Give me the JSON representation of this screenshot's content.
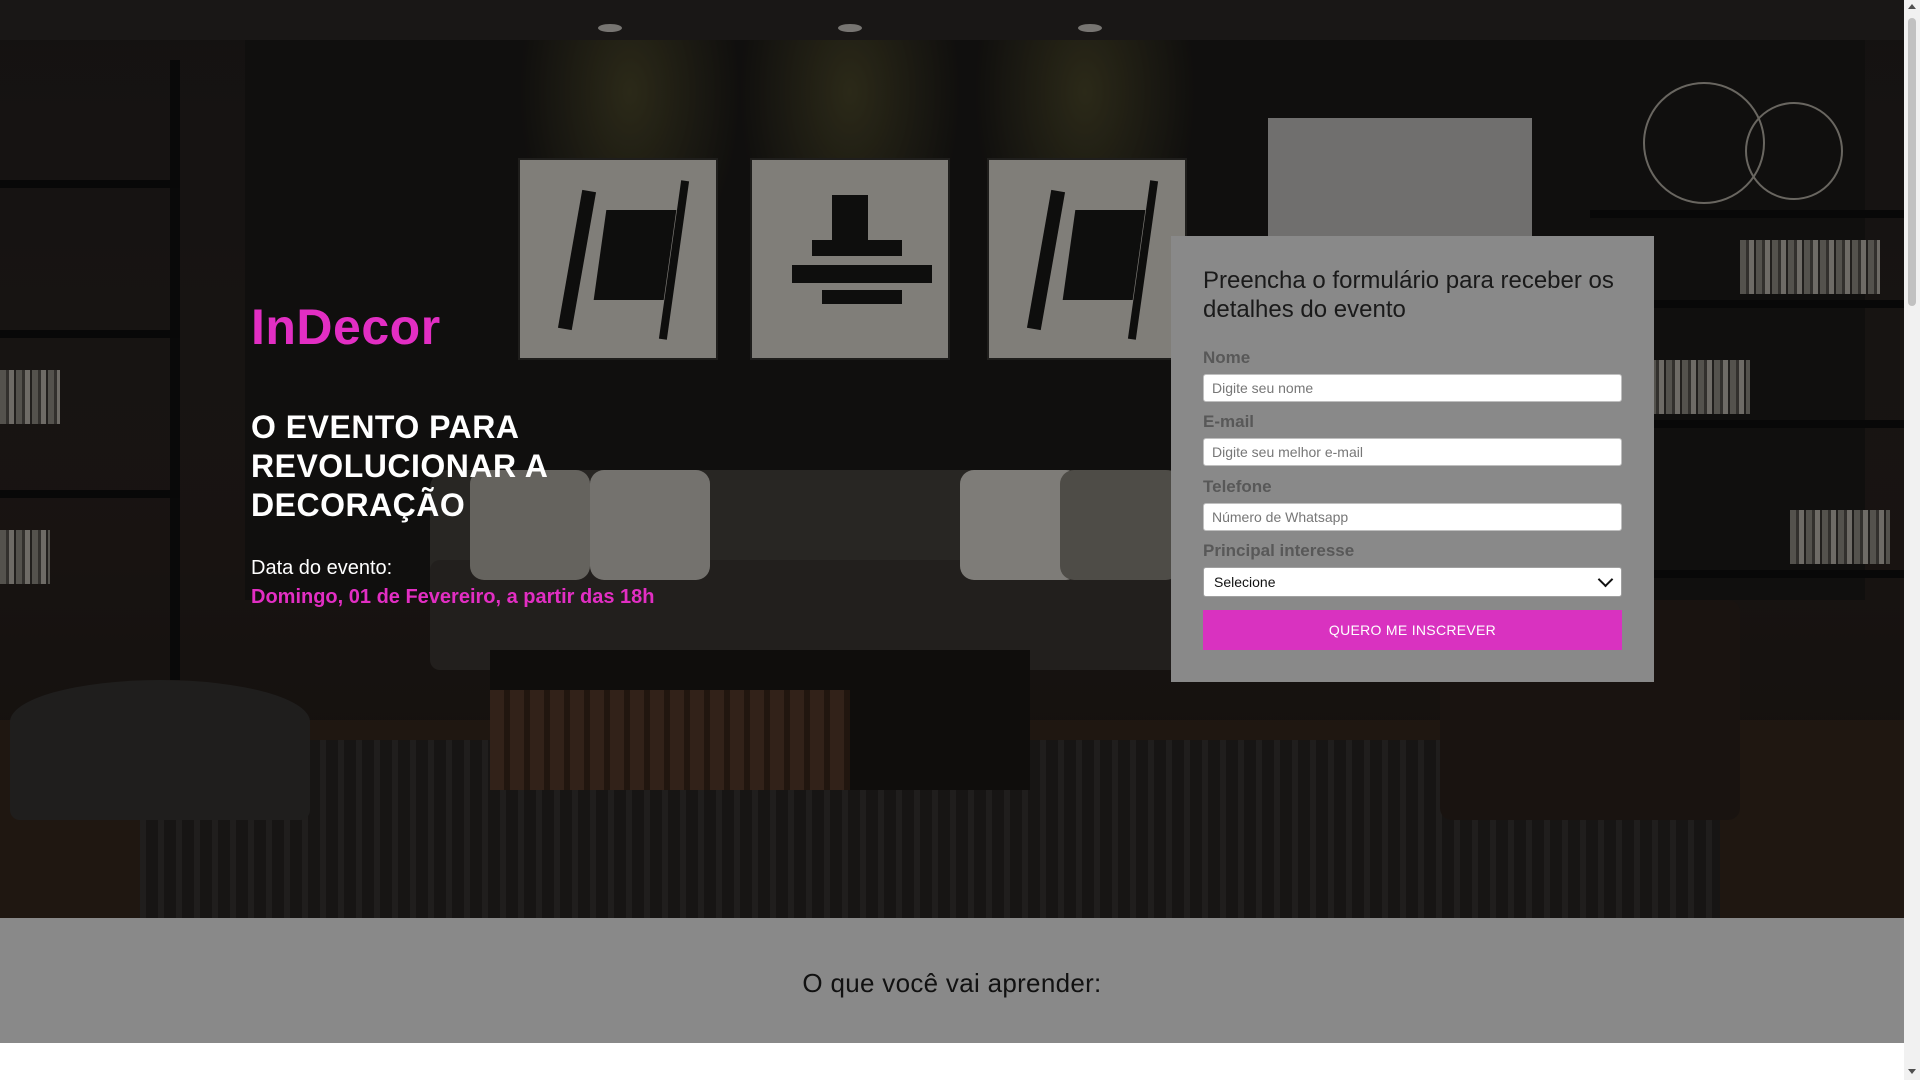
{
  "hero": {
    "brand": "InDecor",
    "headline": "O EVENTO PARA REVOLUCIONAR A DECORAÇÃO",
    "date_label": "Data do evento:",
    "date_value": "Domingo, 01 de Fevereiro, a partir das 18h"
  },
  "form": {
    "title": "Preencha o formulário para receber os detalhes do evento",
    "fields": {
      "name": {
        "label": "Nome",
        "placeholder": "Digite seu nome",
        "value": ""
      },
      "email": {
        "label": "E-mail",
        "placeholder": "Digite seu melhor e-mail",
        "value": ""
      },
      "phone": {
        "label": "Telefone",
        "placeholder": "Número de Whatsapp",
        "value": ""
      },
      "interest": {
        "label": "Principal interesse",
        "selected": "Selecione"
      }
    },
    "submit_label": "QUERO ME INSCREVER"
  },
  "learn": {
    "title": "O que você vai aprender:"
  },
  "colors": {
    "accent": "#e22ec3",
    "button": "#d932c0",
    "panel_gray": "#898989"
  },
  "icons": {
    "select_arrow": "chevron-down-icon",
    "scroll_up": "scroll-up-arrow-icon",
    "scroll_down": "scroll-down-arrow-icon"
  }
}
